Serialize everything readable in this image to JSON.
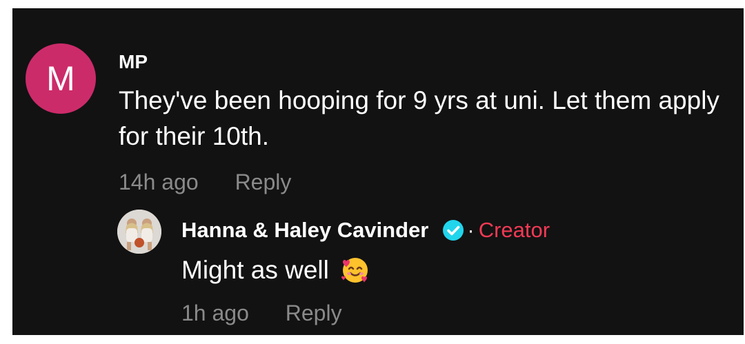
{
  "comment": {
    "avatar_letter": "M",
    "avatar_color": "#cc2b6a",
    "author": "MP",
    "text": "They've been hooping for 9 yrs at uni. Let them apply for their 10th.",
    "time": "14h ago",
    "reply_label": "Reply"
  },
  "reply": {
    "avatar_icon": "profile-photo-icon",
    "author": "Hanna & Haley Cavinder",
    "verified_icon": "verified-badge-icon",
    "separator": "·",
    "badge": "Creator",
    "badge_color": "#f23a55",
    "text": "Might as well",
    "emoji_icon": "smiling-face-with-hearts-icon",
    "time": "1h ago",
    "reply_label": "Reply"
  }
}
